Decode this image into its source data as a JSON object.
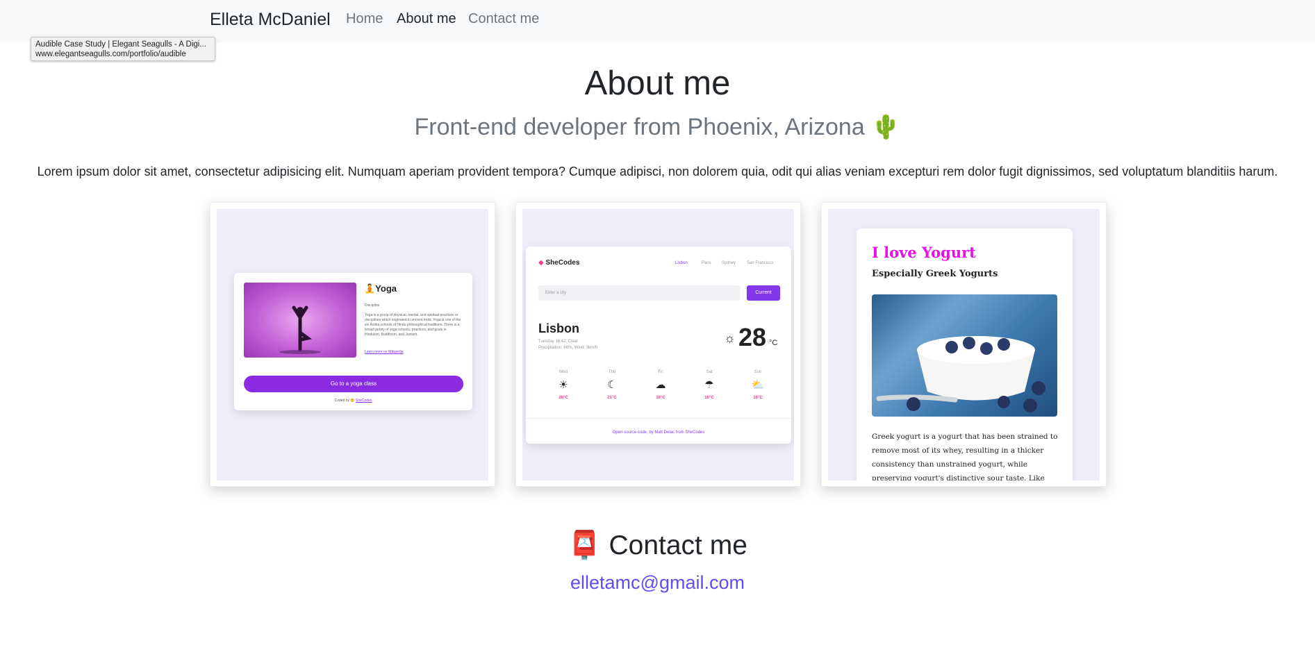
{
  "navbar": {
    "brand": "Elleta McDaniel",
    "links": [
      {
        "label": "Home",
        "active": false
      },
      {
        "label": "About me",
        "active": true
      },
      {
        "label": "Contact me",
        "active": false
      }
    ]
  },
  "tooltip": {
    "title": "Audible Case Study | Elegant Seagulls - A Digi...",
    "url": "www.elegantseagulls.com/portfolio/audible"
  },
  "about": {
    "title": "About me",
    "subtitle": "Front-end developer from Phoenix, Arizona 🌵",
    "intro": "Lorem ipsum dolor sit amet, consectetur adipisicing elit. Numquam aperiam provident tempora? Cumque adipisci, non dolorem quia, odit qui alias veniam excepturi rem dolor fugit dignissimos, sed voluptatum blanditiis harum."
  },
  "projects": {
    "yoga": {
      "title": "🧘Yoga",
      "discipline": "Discipline",
      "description": "Yoga is a group of physical, mental, and spiritual practices or disciplines which originated in ancient India. Yoga is one of the six Āstika schools of Hindu philosophical traditions. There is a broad variety of yoga schools, practices, and goals in Hinduism, Buddhism, and Jainism.",
      "link": "Learn more on Wikipedia",
      "button": "Go to a yoga class",
      "footer_prefix": "Coded by 🙂",
      "footer_link": "SheCodes"
    },
    "weather": {
      "logo": "SheCodes",
      "nav": [
        "Lisbon",
        "Paris",
        "Sydney",
        "San Francisco"
      ],
      "search_placeholder": "Enter a city",
      "button": "Current",
      "city": "Lisbon",
      "date": "Tuesday 16:42, Clear",
      "details": "Precipitation: 66%, Wind: 3km/h",
      "temperature": "28",
      "unit": "°C",
      "forecast": [
        {
          "day": "Wed",
          "icon": "☀",
          "temp": "28°C"
        },
        {
          "day": "Thu",
          "icon": "☾",
          "temp": "21°C"
        },
        {
          "day": "Fri",
          "icon": "☁",
          "temp": "16°C"
        },
        {
          "day": "Sat",
          "icon": "☂",
          "temp": "16°C"
        },
        {
          "day": "Sun",
          "icon": "⛅",
          "temp": "16°C"
        }
      ],
      "footer": "Open-source code, by Matt Delac from SheCodes"
    },
    "yogurt": {
      "title": "I love Yogurt",
      "subtitle": "Especially Greek Yogurts",
      "text": "Greek yogurt is a yogurt that has been strained to remove most of its whey, resulting in a thicker consistency than unstrained yogurt, while preserving yogurt's distinctive sour taste. Like many types of yogurt, strained yogurt is"
    }
  },
  "contact": {
    "title": "📮 Contact me",
    "email": "elletamc@gmail.com"
  }
}
